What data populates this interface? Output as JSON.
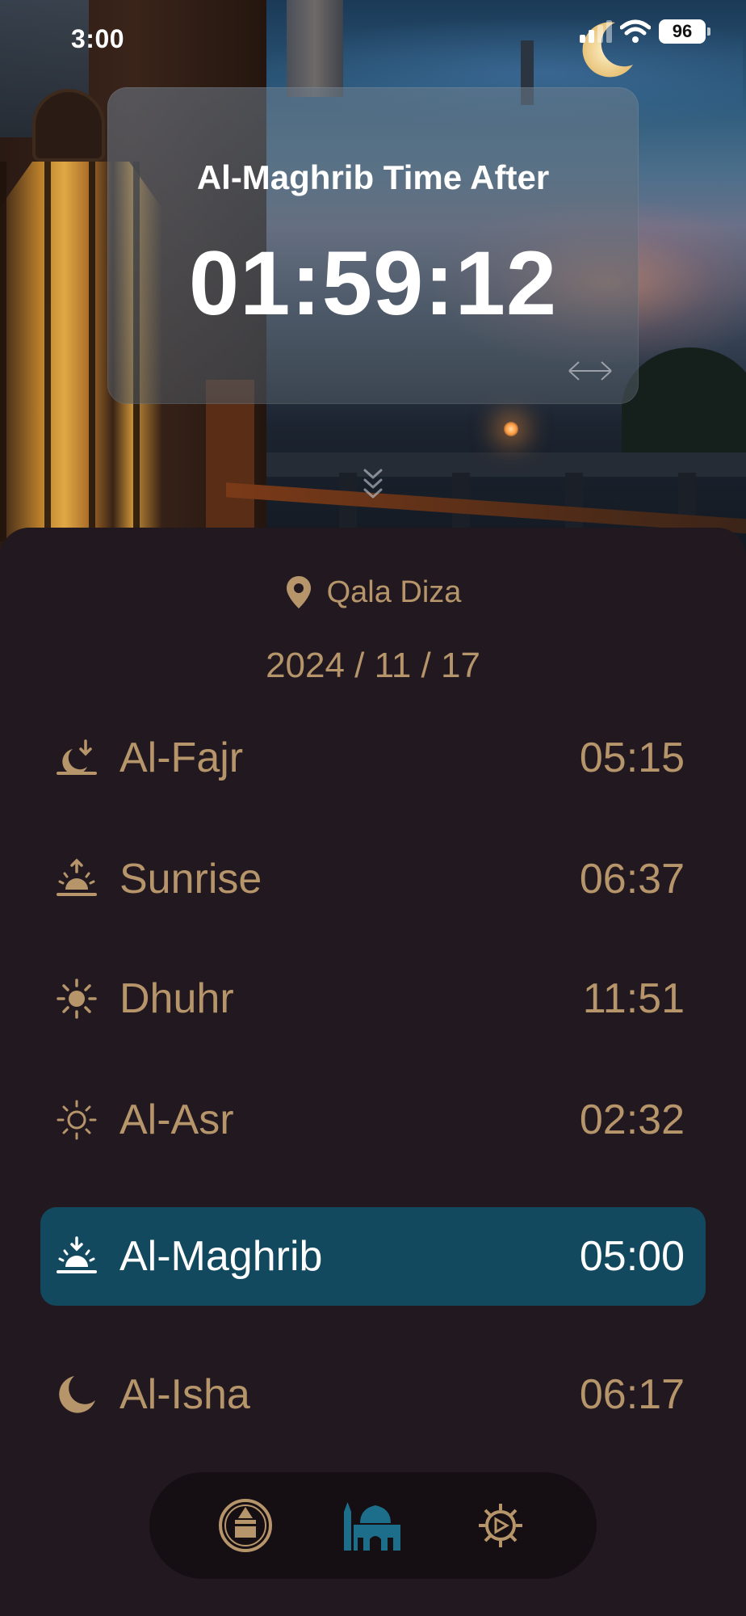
{
  "status_bar": {
    "time": "3:00",
    "battery": "96",
    "signal_bars": 2
  },
  "countdown": {
    "title": "Al-Maghrib Time After",
    "value": "01:59:12"
  },
  "location": {
    "icon": "map-pin-icon",
    "name": "Qala Diza"
  },
  "date": "2024 / 11 / 17",
  "prayers": [
    {
      "name": "Al-Fajr",
      "time": "05:15",
      "icon": "fajr-moon-icon",
      "active": false
    },
    {
      "name": "Sunrise",
      "time": "06:37",
      "icon": "sunrise-icon",
      "active": false
    },
    {
      "name": "Dhuhr",
      "time": "11:51",
      "icon": "sun-icon",
      "active": false
    },
    {
      "name": "Al-Asr",
      "time": "02:32",
      "icon": "sun-outline-icon",
      "active": false
    },
    {
      "name": "Al-Maghrib",
      "time": "05:00",
      "icon": "sunset-icon",
      "active": true
    },
    {
      "name": "Al-Isha",
      "time": "06:17",
      "icon": "moon-icon",
      "active": false
    }
  ],
  "tabs": [
    {
      "id": "qibla",
      "icon": "kaaba-compass-icon",
      "active": false
    },
    {
      "id": "prayer-times",
      "icon": "mosque-icon",
      "active": true
    },
    {
      "id": "settings",
      "icon": "gear-icon",
      "active": false
    }
  ],
  "colors": {
    "accent_gold": "#b7956a",
    "active_row": "#12495e",
    "active_tab": "#1d6e8a",
    "sheet_bg": "#221920"
  }
}
